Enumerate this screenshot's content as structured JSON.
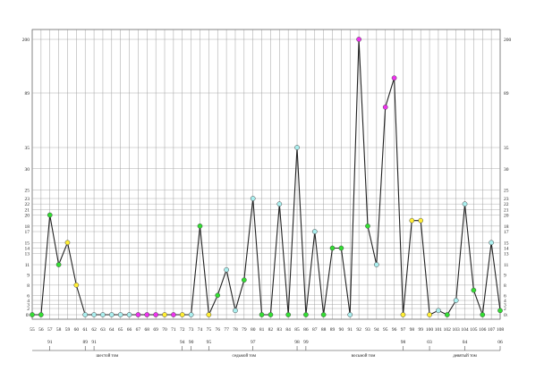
{
  "chart_data": {
    "type": "line",
    "x": [
      55,
      56,
      57,
      58,
      59,
      60,
      61,
      62,
      63,
      64,
      65,
      66,
      67,
      68,
      69,
      70,
      71,
      72,
      73,
      74,
      75,
      76,
      77,
      78,
      79,
      80,
      81,
      82,
      83,
      84,
      85,
      86,
      87,
      88,
      89,
      90,
      91,
      92,
      93,
      94,
      95,
      96,
      97,
      98,
      99,
      100,
      101,
      102,
      103,
      104,
      105,
      106,
      107,
      108
    ],
    "y": [
      0.5,
      0.5,
      20,
      11,
      15,
      7,
      0.5,
      0.5,
      0.5,
      0.5,
      0.5,
      0.5,
      0.5,
      0.5,
      0.5,
      0.5,
      0.5,
      0.5,
      0.5,
      18,
      0.5,
      5,
      10,
      1.5,
      8,
      23,
      0.5,
      0.5,
      22,
      0.5,
      35,
      0.5,
      17,
      0.5,
      14,
      14,
      0.5,
      200,
      18,
      11,
      75,
      120,
      0.5,
      19,
      19,
      0.5,
      1.5,
      0.5,
      4,
      22,
      6,
      0.5,
      15,
      1.5
    ],
    "marker_colors": [
      "#33dd33",
      "#33dd33",
      "#33dd33",
      "#33dd33",
      "#ffee33",
      "#ffee33",
      "#aaeeee",
      "#aaeeee",
      "#aaeeee",
      "#aaeeee",
      "#aaeeee",
      "#aaeeee",
      "#ee33ee",
      "#ee33ee",
      "#ee33ee",
      "#ffee33",
      "#ee33ee",
      "#ffee33",
      "#aaeeee",
      "#33dd33",
      "#ffee33",
      "#33dd33",
      "#aaeeee",
      "#aaeeee",
      "#33dd33",
      "#aaeeee",
      "#33dd33",
      "#33dd33",
      "#aaeeee",
      "#33dd33",
      "#aaeeee",
      "#33dd33",
      "#aaeeee",
      "#33dd33",
      "#33dd33",
      "#33dd33",
      "#aaeeee",
      "#ee33ee",
      "#33dd33",
      "#aaeeee",
      "#ee33ee",
      "#ee33ee",
      "#ffee33",
      "#ffee33",
      "#ffee33",
      "#ffee33",
      "#aaeeee",
      "#33dd33",
      "#aaeeee",
      "#aaeeee",
      "#33dd33",
      "#33dd33",
      "#aaeeee",
      "#33dd33"
    ],
    "y_ticks": [
      0.5,
      2,
      3,
      4,
      5,
      7,
      9,
      11,
      13,
      14,
      15,
      17,
      18,
      20,
      21,
      22,
      23,
      25,
      30,
      35,
      89,
      200
    ],
    "y_tick_labels": [
      "0\\",
      "2",
      "3",
      "4",
      "6",
      "8",
      "9",
      "11",
      "13",
      "14",
      "15",
      "17",
      "18",
      "20",
      "21",
      "22",
      "23",
      "25",
      "30",
      "35",
      "89",
      "200"
    ],
    "y_tick_labels_right": [
      "0\\",
      "2",
      "3",
      "4",
      "6",
      "8",
      "9",
      "11",
      "13",
      "14",
      "15",
      "17",
      "18",
      "20",
      "21",
      "22",
      "23",
      "25",
      "30",
      "35",
      "89",
      "200"
    ],
    "x_tick_labels": [
      "55",
      "56",
      "57",
      "58",
      "59",
      "60",
      "61",
      "62",
      "63",
      "64",
      "65",
      "66",
      "67",
      "68",
      "69",
      "70",
      "71",
      "72",
      "73",
      "74",
      "75",
      "76",
      "77",
      "78",
      "79",
      "80",
      "81",
      "82",
      "83",
      "84",
      "85",
      "86",
      "87",
      "88",
      "89",
      "90",
      "91",
      "92",
      "93",
      "94",
      "95",
      "96",
      "97",
      "98",
      "99",
      "100",
      "101",
      "102",
      "103",
      "104",
      "105",
      "106",
      "107",
      "108"
    ],
    "group_marks": [
      {
        "x": 57,
        "label": "91"
      },
      {
        "x": 61,
        "label": "89"
      },
      {
        "x": 62,
        "label": "91"
      },
      {
        "x": 72,
        "label": "94"
      },
      {
        "x": 73,
        "label": "90"
      },
      {
        "x": 75,
        "label": "95"
      },
      {
        "x": 80,
        "label": "97"
      },
      {
        "x": 85,
        "label": "98"
      },
      {
        "x": 86,
        "label": "99"
      },
      {
        "x": 97,
        "label": "98"
      },
      {
        "x": 100,
        "label": "03"
      },
      {
        "x": 104,
        "label": "04"
      },
      {
        "x": 108,
        "label": "06"
      }
    ],
    "volumes": [
      {
        "label": "шестой том",
        "from": 55,
        "to": 72
      },
      {
        "label": "седьмой том",
        "from": 73,
        "to": 85
      },
      {
        "label": "восьмой том",
        "from": 86,
        "to": 99
      },
      {
        "label": "девятый том",
        "from": 100,
        "to": 108
      }
    ],
    "grid": true
  }
}
